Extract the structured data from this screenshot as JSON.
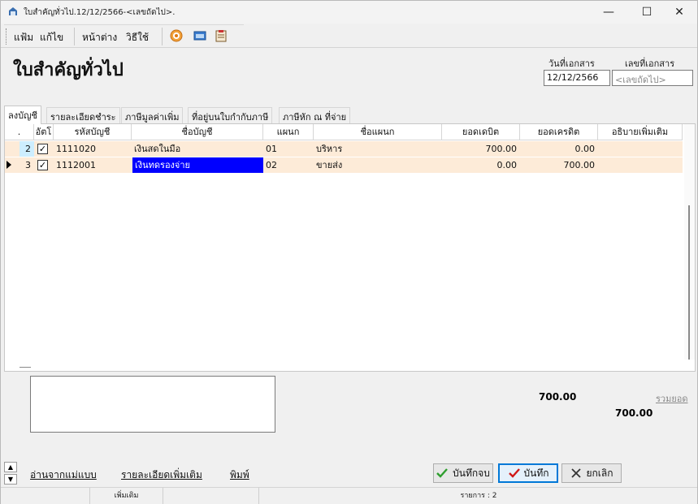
{
  "window": {
    "title": "ใบสำคัญทั่วไป.12/12/2566-<เลขถัดไป>.",
    "min": "—",
    "max": "☐",
    "close": "✕"
  },
  "menu": {
    "file": "แฟ้ม",
    "edit": "แก้ไข",
    "window": "หน้าต่าง",
    "help": "วิธีใช้"
  },
  "header": {
    "title": "ใบสำคัญทั่วไป",
    "date_label": "วันที่เอกสาร",
    "date_value": "12/12/2566",
    "docno_label": "เลขที่เอกสาร",
    "docno_placeholder": "<เลขถัดไป>"
  },
  "tabs": [
    {
      "label": "ลงบัญชี"
    },
    {
      "label": "รายละเอียดชำระ"
    },
    {
      "label": "ภาษีมูลค่าเพิ่ม"
    },
    {
      "label": "ที่อยู่บนใบกำกับภาษี"
    },
    {
      "label": "ภาษีหัก ณ ที่จ่าย"
    }
  ],
  "grid": {
    "columns": [
      ".",
      "อัตโ",
      "รหัสบัญชี",
      "ชื่อบัญชี",
      "แผนก",
      "ชื่อแผนก",
      "ยอดเดบิต",
      "ยอดเครดิต",
      "อธิบายเพิ่มเติม"
    ],
    "rows": [
      {
        "no": "2",
        "checked": "✓",
        "code": "1111020",
        "name": "เงินสดในมือ",
        "dept": "01",
        "dept_name": "บริหาร",
        "debit": "700.00",
        "credit": "0.00",
        "note": ""
      },
      {
        "no": "3",
        "checked": "✓",
        "code": "1112001",
        "name": "เงินทดรองจ่าย",
        "dept": "02",
        "dept_name": "ขายส่ง",
        "debit": "0.00",
        "credit": "700.00",
        "note": ""
      }
    ]
  },
  "totals": {
    "debit": "700.00",
    "credit": "700.00",
    "link": "รวมยอด"
  },
  "links": {
    "template": "อ่านจากแม่แบบ",
    "more": "รายละเอียดเพิ่มเติม",
    "print": "พิมพ์"
  },
  "buttons": {
    "save_close": "บันทึกจบ",
    "save": "บันทึก",
    "cancel": "ยกเลิก"
  },
  "status": {
    "mode": "เพิ่มเติม",
    "items": "รายการ : 2"
  },
  "colors": {
    "row_bg": "#fdebd8",
    "selection": "#0000ff",
    "default_button": "#0078d7"
  }
}
